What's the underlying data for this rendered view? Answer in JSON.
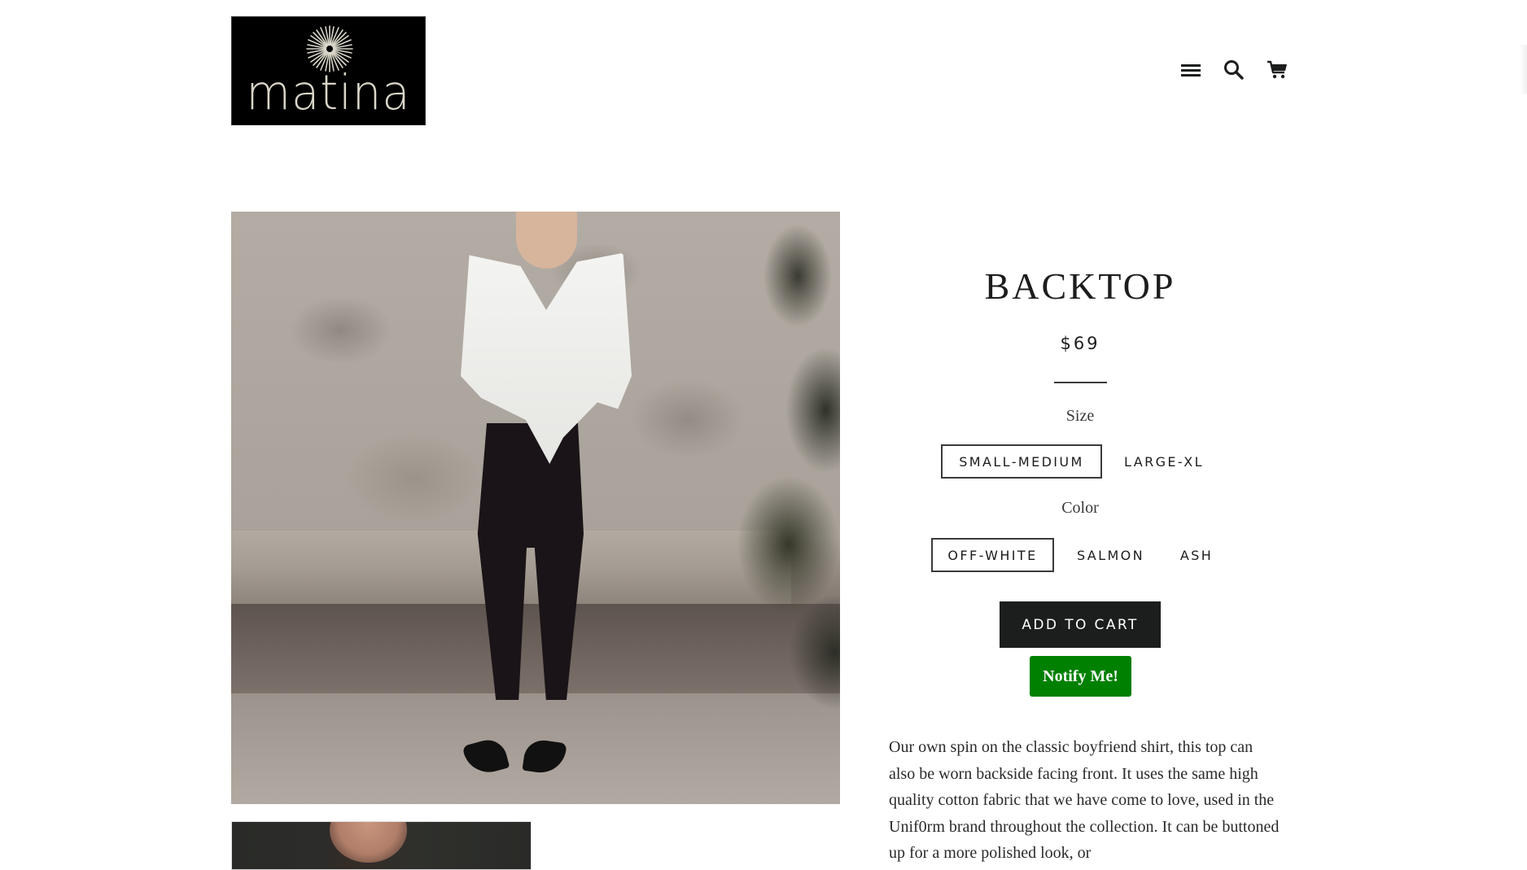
{
  "header": {
    "logo_text": "matina",
    "icons": {
      "menu": "hamburger-menu-icon",
      "search": "search-icon",
      "cart": "cart-icon"
    }
  },
  "product": {
    "title": "BACKTOP",
    "price": "$69",
    "images": {
      "main": "model wearing white off-shoulder shirt and ripped black jeans against concrete wall",
      "thumbnail": "close-up of model in shirt"
    },
    "options": [
      {
        "label": "Size",
        "values": [
          "SMALL-MEDIUM",
          "LARGE-XL"
        ],
        "selected": "SMALL-MEDIUM"
      },
      {
        "label": "Color",
        "values": [
          "OFF-WHITE",
          "SALMON",
          "ASH"
        ],
        "selected": "OFF-WHITE"
      }
    ],
    "add_to_cart_label": "ADD TO CART",
    "notify_label": "Notify Me!",
    "description": "Our own spin on the classic boyfriend shirt, this top can also be worn backside facing front. It uses the same high quality cotton fabric that we have come to love, used in the Unif0rm brand throughout the collection. It can be buttoned up for a more polished look, or"
  },
  "colors": {
    "text": "#1c1d1d",
    "button_dark": "#1c1d1d",
    "notify_green": "#008000",
    "logo_bg": "#000000"
  }
}
